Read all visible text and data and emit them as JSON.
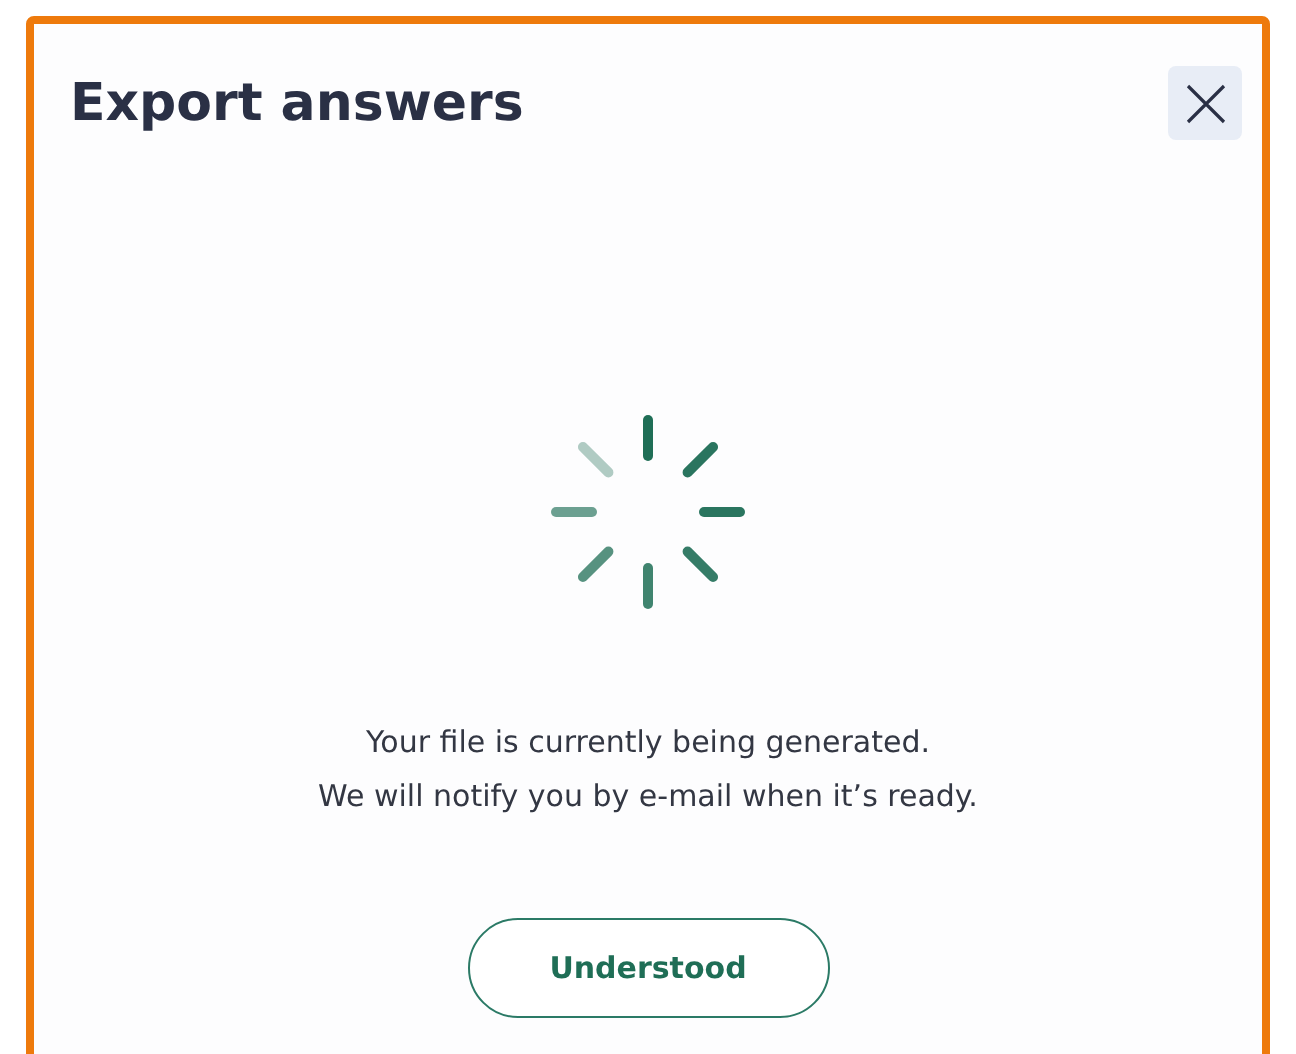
{
  "dialog": {
    "title": "Export answers",
    "message_lines": [
      "Your file is currently being generated.",
      "We will notify you by e-mail when it’s ready."
    ],
    "button": "Understood"
  }
}
